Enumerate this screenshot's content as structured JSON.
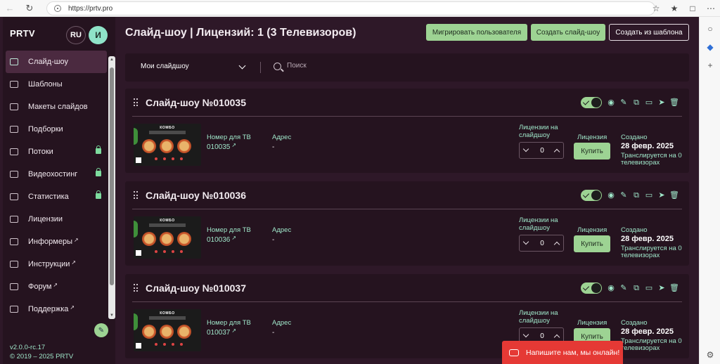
{
  "browser": {
    "url": "https://prtv.pro"
  },
  "sidebar": {
    "brand": "PRTV",
    "lang": "RU",
    "avatar": "И",
    "items": [
      {
        "label": "Слайд-шоу",
        "active": true
      },
      {
        "label": "Шаблоны"
      },
      {
        "label": "Макеты слайдов"
      },
      {
        "label": "Подборки"
      },
      {
        "label": "Потоки",
        "locked": true
      },
      {
        "label": "Видеохостинг",
        "locked": true
      },
      {
        "label": "Статистика",
        "locked": true
      },
      {
        "label": "Лицензии"
      },
      {
        "label": "Информеры",
        "external": true
      },
      {
        "label": "Инструкции",
        "external": true
      },
      {
        "label": "Форум",
        "external": true
      },
      {
        "label": "Поддержка",
        "external": true
      }
    ],
    "version": "v2.0.0-rc.17",
    "copyright": "© 2019 – 2025 PRTV"
  },
  "header": {
    "title": "Слайд-шоу | Лицензий: 1 (3 Телевизоров)",
    "migrate_label": "Мигрировать пользователя",
    "create_label": "Создать слайд-шоу",
    "template_label": "Создать из шаблона"
  },
  "filter": {
    "selected": "Мои слайдшоу",
    "search_placeholder": "Поиск"
  },
  "labels": {
    "tv_number": "Номер для ТВ",
    "address": "Адрес",
    "licenses": "Лицензии на слайдшоу",
    "license": "Лицензия",
    "created": "Создано",
    "buy": "Купить"
  },
  "thumb_text": "КОМБО",
  "slideshows": [
    {
      "title": "Слайд-шоу №010035",
      "tv_number": "010035",
      "address": "-",
      "licenses": "0",
      "created": "28 февр. 2025",
      "status": "Транслируется на 0 телевизорах"
    },
    {
      "title": "Слайд-шоу №010036",
      "tv_number": "010036",
      "address": "-",
      "licenses": "0",
      "created": "28 февр. 2025",
      "status": "Транслируется на 0 телевизорах"
    },
    {
      "title": "Слайд-шоу №010037",
      "tv_number": "010037",
      "address": "-",
      "licenses": "0",
      "created": "28 февр. 2025",
      "status": "Транслируется на 0 телевизорах"
    }
  ],
  "chat": {
    "label": "Напишите нам, мы онлайн!"
  },
  "colors": {
    "accent": "#9dd393",
    "mint": "#9fe6c9",
    "background": "#2e1828",
    "panel": "#25131f",
    "chat": "#e53935"
  }
}
